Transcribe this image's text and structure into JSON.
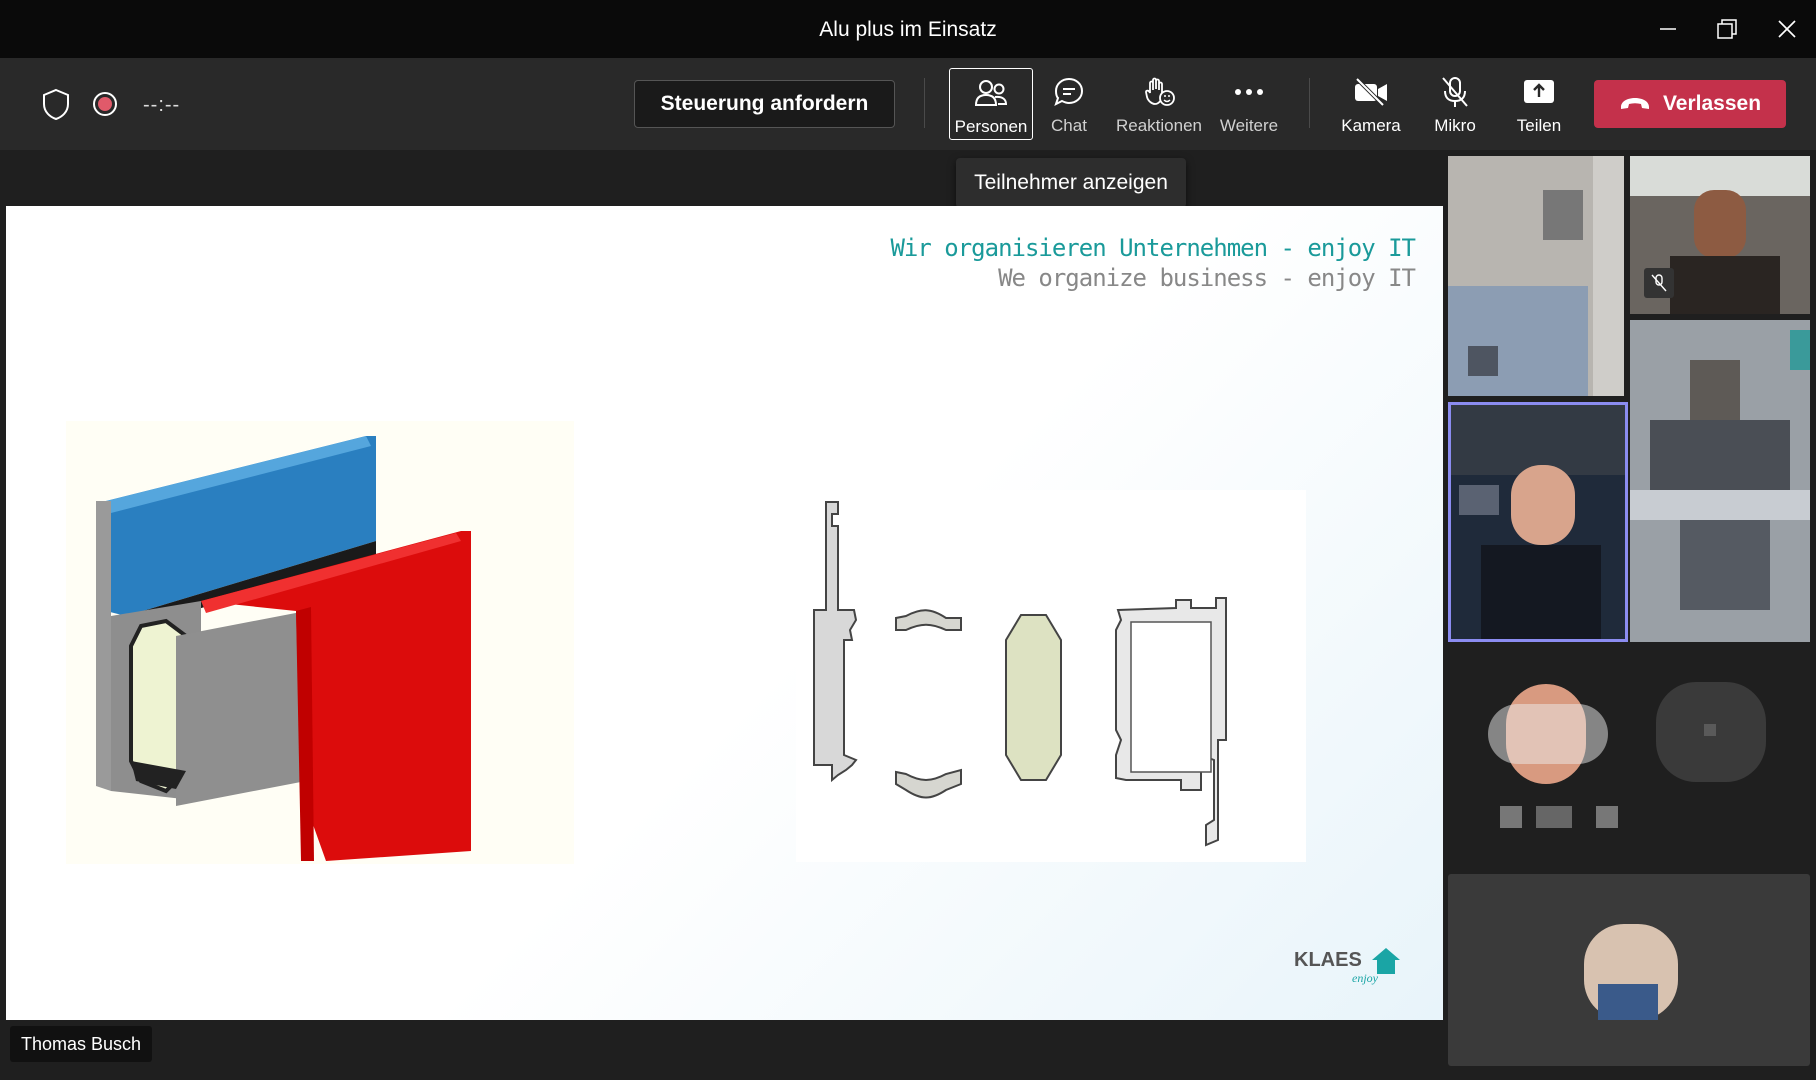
{
  "window": {
    "title": "Alu plus im Einsatz"
  },
  "toolbar": {
    "timer": "--:--",
    "request_control_label": "Steuerung anfordern",
    "tools": [
      {
        "label": "Personen",
        "icon": "people-icon"
      },
      {
        "label": "Chat",
        "icon": "chat-icon"
      },
      {
        "label": "Reaktionen",
        "icon": "reactions-icon"
      },
      {
        "label": "Weitere",
        "icon": "more-icon"
      },
      {
        "label": "Kamera",
        "icon": "camera-off-icon"
      },
      {
        "label": "Mikro",
        "icon": "mic-off-icon"
      },
      {
        "label": "Teilen",
        "icon": "share-icon"
      }
    ],
    "leave_label": "Verlassen"
  },
  "tooltip": {
    "text": "Teilnehmer anzeigen"
  },
  "slide": {
    "tagline_de": "Wir organisieren Unternehmen - enjoy IT",
    "tagline_en": "We organize business - enjoy IT",
    "logo_text": "KLAES",
    "logo_sub": "enjoy"
  },
  "presenter": {
    "name": "Thomas Busch"
  },
  "colors": {
    "leave": "#c4314b",
    "active_speaker": "#8b8cf0",
    "tagline": "#1a9a9a"
  }
}
